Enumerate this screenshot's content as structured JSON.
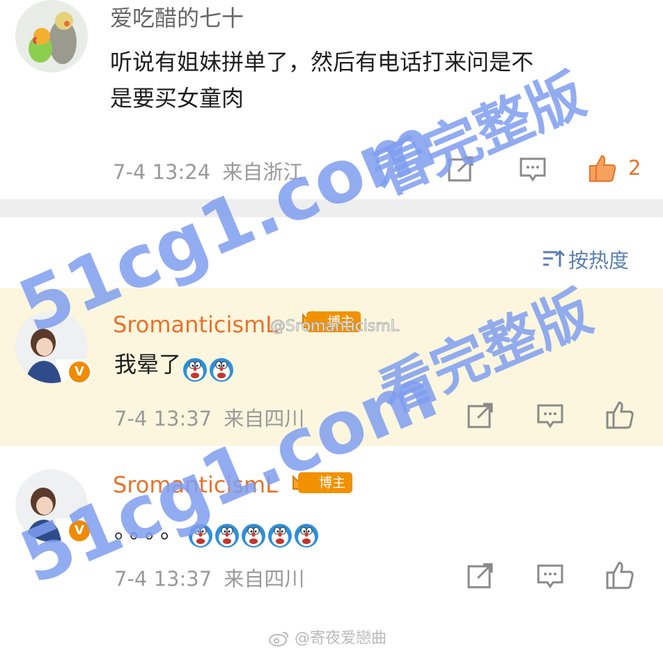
{
  "comments": [
    {
      "username": "爱吃醋的七十",
      "text_line1": "听说有姐妹拼单了，然后有电话打来问是不",
      "text_line2": "是要买女童肉",
      "timestamp": "7-4 13:24",
      "location": "来自浙江",
      "likes": "2",
      "liked": true
    },
    {
      "username": "SromanticismL",
      "badge": "博主",
      "verified_mark": "V",
      "text": "我晕了",
      "emoji_count": 2,
      "timestamp": "7-4 13:37",
      "location": "来自四川",
      "highlighted": true,
      "overlay_watermark": "@SromanticismL"
    },
    {
      "username": "SromanticismL",
      "badge": "博主",
      "verified_mark": "V",
      "text": "。。。。",
      "emoji_count": 5,
      "timestamp": "7-4 13:37",
      "location": "来自四川"
    }
  ],
  "sort": {
    "label": "按热度",
    "icon": "sort-icon"
  },
  "watermarks": {
    "site_text_1": "51cg1.com",
    "promo_text_1": "看完整版",
    "site_text_2": "51cg1.com",
    "promo_text_2": "看完整版",
    "site_text_3": "51cg1.com",
    "weibo_bottom": "@寄夜爱戀曲"
  },
  "colors": {
    "username_orange": "#e9712a",
    "highlight_bg": "#fbf6dd",
    "divider_gray": "#eeeeee",
    "watermark_blue": "#7f9ef0"
  },
  "icons": [
    "repost-icon",
    "comment-icon",
    "like-icon",
    "crown-icon",
    "doraemon-emoji-icon",
    "sort-icon"
  ]
}
